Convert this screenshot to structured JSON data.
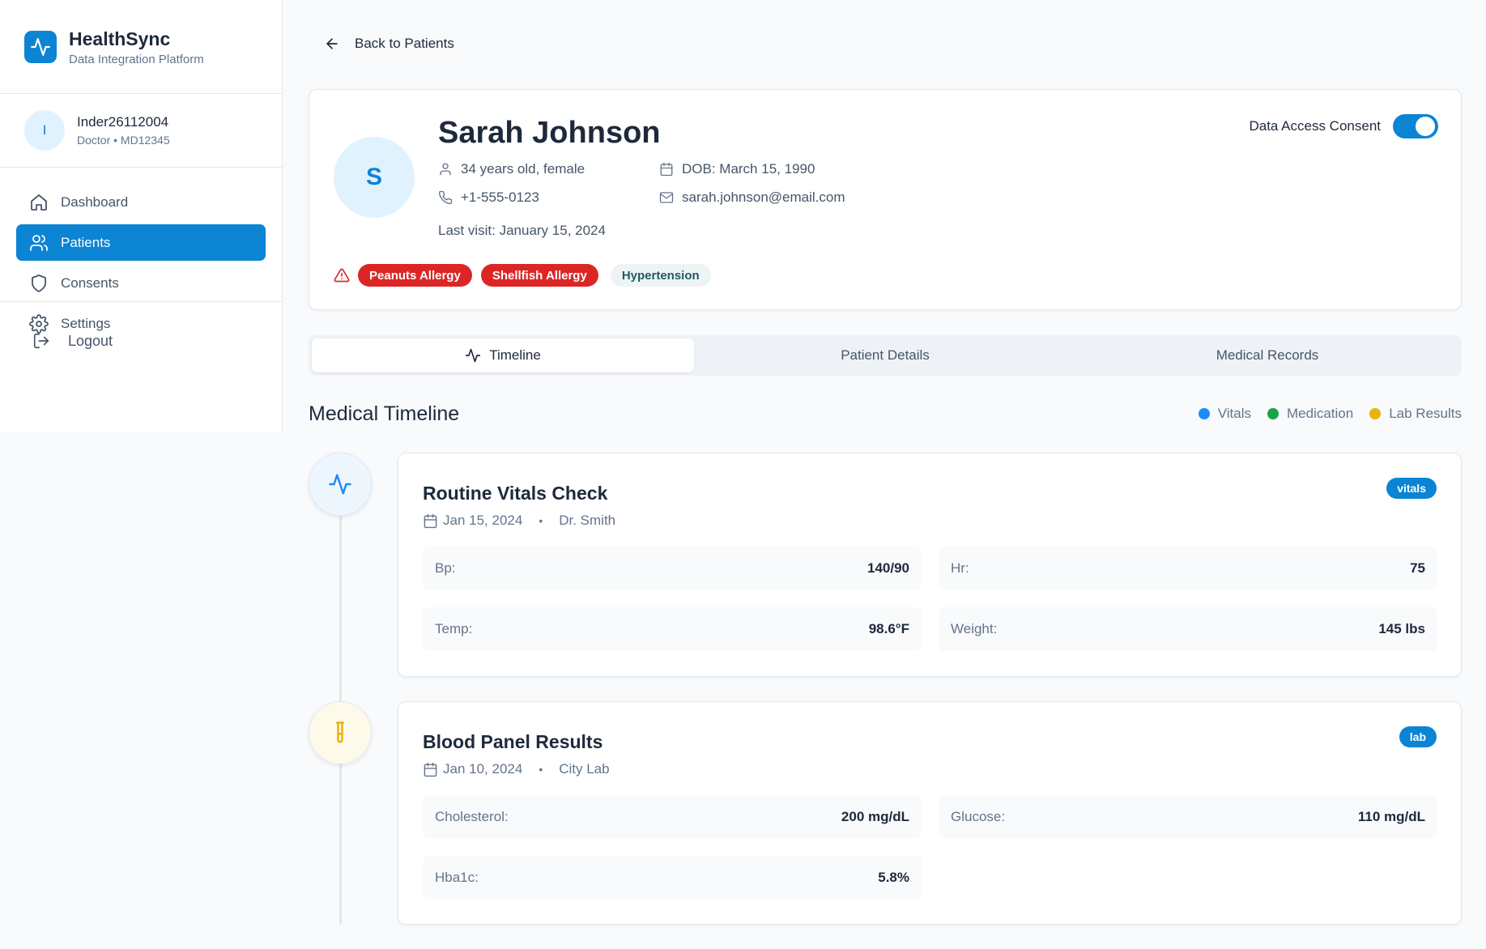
{
  "app": {
    "name": "HealthSync",
    "subtitle": "Data Integration Platform"
  },
  "user": {
    "initial": "I",
    "name": "Inder26112004",
    "role": "Doctor • MD12345"
  },
  "nav": {
    "items": [
      {
        "label": "Dashboard",
        "icon": "home-icon"
      },
      {
        "label": "Patients",
        "icon": "users-icon",
        "active": true
      },
      {
        "label": "Consents",
        "icon": "shield-icon"
      },
      {
        "label": "Settings",
        "icon": "gear-icon"
      }
    ],
    "logout": "Logout"
  },
  "back_label": "Back to Patients",
  "patient": {
    "initial": "S",
    "name": "Sarah Johnson",
    "age_gender": "34 years old, female",
    "dob": "DOB: March 15, 1990",
    "phone": "+1-555-0123",
    "email": "sarah.johnson@email.com",
    "last_visit": "Last visit: January 15, 2024",
    "consent_label": "Data Access Consent",
    "consent_enabled": true,
    "allergies": [
      "Peanuts Allergy",
      "Shellfish Allergy"
    ],
    "conditions": [
      "Hypertension"
    ]
  },
  "tabs": [
    {
      "label": "Timeline",
      "active": true
    },
    {
      "label": "Patient Details"
    },
    {
      "label": "Medical Records"
    }
  ],
  "timeline": {
    "title": "Medical Timeline",
    "legend": [
      {
        "label": "Vitals",
        "color": "#1d8cf8"
      },
      {
        "label": "Medication",
        "color": "#16a34a"
      },
      {
        "label": "Lab Results",
        "color": "#eab308"
      }
    ],
    "events": [
      {
        "title": "Routine Vitals Check",
        "date": "Jan 15, 2024",
        "provider": "Dr. Smith",
        "badge": "vitals",
        "icon": "activity-icon",
        "metrics": [
          {
            "label": "Bp:",
            "value": "140/90"
          },
          {
            "label": "Hr:",
            "value": "75"
          },
          {
            "label": "Temp:",
            "value": "98.6°F"
          },
          {
            "label": "Weight:",
            "value": "145 lbs"
          }
        ]
      },
      {
        "title": "Blood Panel Results",
        "date": "Jan 10, 2024",
        "provider": "City Lab",
        "badge": "lab",
        "icon": "test-tube-icon",
        "metrics": [
          {
            "label": "Cholesterol:",
            "value": "200 mg/dL"
          },
          {
            "label": "Glucose:",
            "value": "110 mg/dL"
          },
          {
            "label": "Hba1c:",
            "value": "5.8%"
          }
        ]
      }
    ]
  }
}
